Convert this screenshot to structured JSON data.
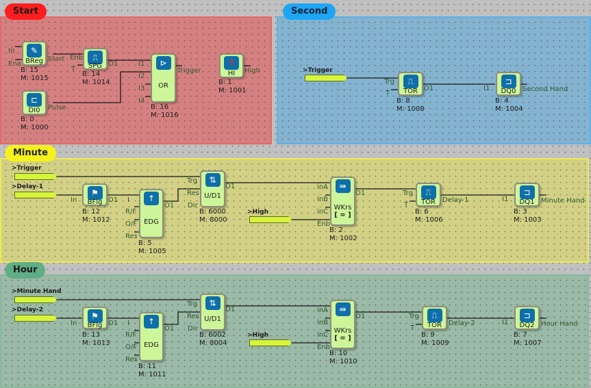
{
  "groups": {
    "start": {
      "label": "Start",
      "color": "#ff1e1e"
    },
    "second": {
      "label": "Second",
      "color": "#1ea6f5"
    },
    "minute": {
      "label": "Minute",
      "color": "#f4f21a"
    },
    "hour": {
      "label": "Hour",
      "color": "#5fae86"
    }
  },
  "blocks": {
    "breg": {
      "name": "BReg",
      "b": "B: 15",
      "m": "M: 1015",
      "pins_in": [
        "In",
        "Ena"
      ],
      "pin_out": "Start",
      "icon": "register-icon"
    },
    "spg": {
      "name": "SPG",
      "b": "B: 14",
      "m": "M: 1014",
      "pins_in": [
        "Enb",
        "T"
      ],
      "pin_out": "O1",
      "icon": "pulse-train-icon"
    },
    "or": {
      "name": "OR",
      "b": "B: 16",
      "m": "M: 1016",
      "pins_in": [
        "I1",
        "I2",
        "I3",
        "I4"
      ],
      "pin_out": "Trigger",
      "icon": "or-gate-icon"
    },
    "hi": {
      "name": "HI",
      "b": "B: 1",
      "m": "M: 1001",
      "pin_out": "High",
      "icon": "up-arrow-icon"
    },
    "di0": {
      "name": "DI0",
      "b": "B: 0",
      "m": "M: 1000",
      "pin_out": "Pulse",
      "icon": "digital-input-icon"
    },
    "tor_s": {
      "name": "TOR",
      "b": "B: 8",
      "m": "M: 1008",
      "pins_in": [
        "Trg",
        "T"
      ],
      "pin_out": "O1",
      "icon": "timer-pulse-icon"
    },
    "dq0": {
      "name": "DQ0",
      "b": "B: 4",
      "m": "M: 1004",
      "pins_in": [
        "I1"
      ],
      "pin_out": "Second Hand",
      "icon": "digital-output-icon"
    },
    "bflg_m": {
      "name": "BFlg",
      "b": "B: 12",
      "m": "M: 1012",
      "pins_in": [
        "In"
      ],
      "pin_out": "O1",
      "icon": "flag-icon"
    },
    "edg_m": {
      "name": "EDG",
      "b": "B: 5",
      "m": "M: 1005",
      "pins_in": [
        "I",
        "R/F",
        "O/F",
        "Res"
      ],
      "pin_out": "O1",
      "icon": "edge-icon"
    },
    "ud_m": {
      "name": "U/D1",
      "b": "B: 6000",
      "m": "M: 8000",
      "pins_in": [
        "Trg",
        "Res",
        "Dir"
      ],
      "pin_out": "O1",
      "icon": "counter-icon"
    },
    "wkrs_m": {
      "name": "WKrs",
      "sub": "[ = ]",
      "b": "B: 2",
      "m": "M: 1002",
      "pins_in": [
        "inA",
        "inB",
        "inC",
        "Enb"
      ],
      "pin_out": "O1",
      "icon": "compare-icon"
    },
    "tor_m": {
      "name": "TOR",
      "b": "B: 6",
      "m": "M: 1006",
      "pins_in": [
        "Trg",
        "T"
      ],
      "pin_out": "Delay-1",
      "icon": "timer-pulse-icon"
    },
    "dq1": {
      "name": "DQ1",
      "b": "B: 3",
      "m": "M: 1003",
      "pins_in": [
        "I1"
      ],
      "pin_out": "Minute Hand",
      "icon": "digital-output-icon"
    },
    "bflg_h": {
      "name": "BFlg",
      "b": "B: 13",
      "m": "M: 1013",
      "pins_in": [
        "In"
      ],
      "pin_out": "O1",
      "icon": "flag-icon"
    },
    "edg_h": {
      "name": "EDG",
      "b": "B: 11",
      "m": "M: 1011",
      "pins_in": [
        "I",
        "R/F",
        "O/F",
        "Res"
      ],
      "pin_out": "O1",
      "icon": "edge-icon"
    },
    "ud_h": {
      "name": "U/D1",
      "b": "B: 6002",
      "m": "M: 8004",
      "pins_in": [
        "Trg",
        "Res",
        "Dir"
      ],
      "pin_out": "O1",
      "icon": "counter-icon"
    },
    "wkrs_h": {
      "name": "WKrs",
      "sub": "[ = ]",
      "b": "B: 10",
      "m": "M: 1010",
      "pins_in": [
        "inA",
        "inB",
        "inC",
        "Enb"
      ],
      "pin_out": "O1",
      "icon": "compare-icon"
    },
    "tor_h": {
      "name": "TOR",
      "b": "B: 9",
      "m": "M: 1009",
      "pins_in": [
        "Trg",
        "T"
      ],
      "pin_out": "Delay-2",
      "icon": "timer-pulse-icon"
    },
    "dq2": {
      "name": "DQ2",
      "b": "B: 7",
      "m": "M: 1007",
      "pins_in": [
        "I1"
      ],
      "pin_out": "Hour Hand",
      "icon": "digital-output-icon"
    }
  },
  "connectors": {
    "second_trigger": ">Trigger",
    "minute_trigger": ">Trigger",
    "minute_delay": ">Delay-1",
    "minute_high": ">High",
    "hour_minute": ">Minute Hand",
    "hour_delay": ">Delay-2",
    "hour_high": ">High"
  },
  "colors": {
    "block_fill": "#cdf59a",
    "icon_fill": "#0f6fa8",
    "connector_fill": "#d6f53a",
    "wire": "#1a1a1a"
  }
}
